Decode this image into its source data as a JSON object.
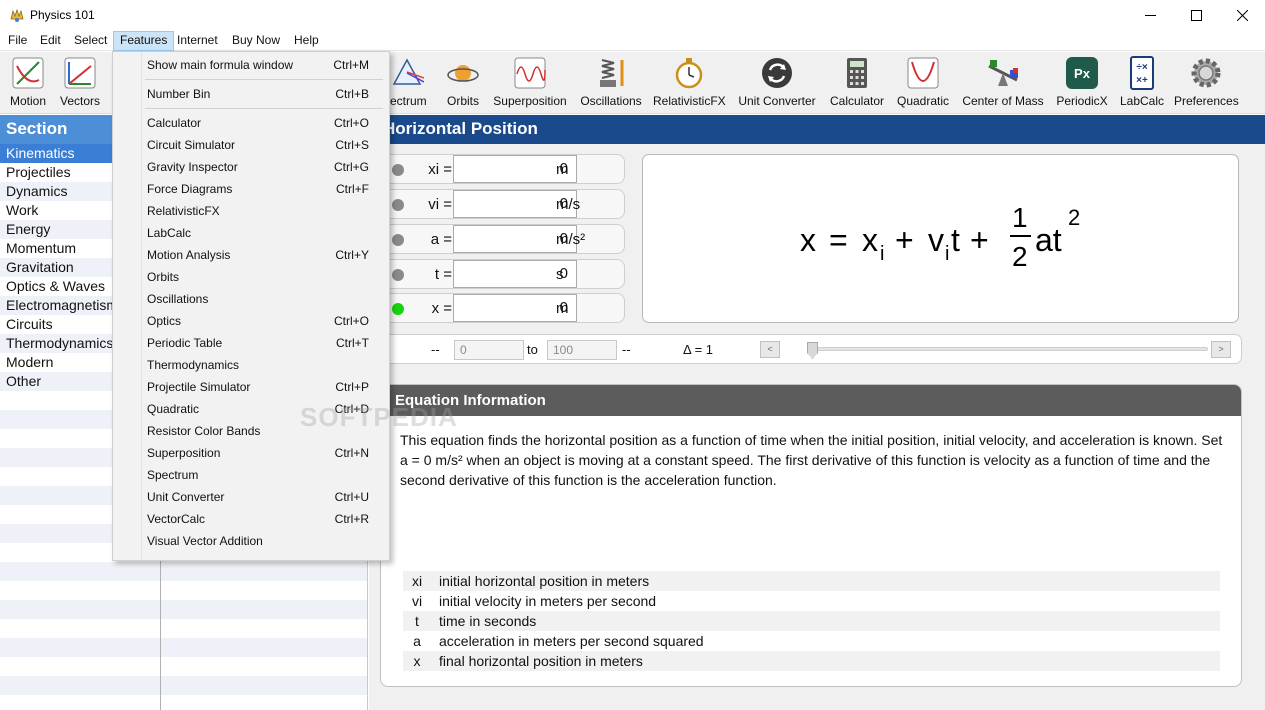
{
  "window": {
    "title": "Physics 101"
  },
  "menubar": [
    "File",
    "Edit",
    "Select",
    "Features",
    "Internet",
    "Buy Now",
    "Help"
  ],
  "toolbar": [
    {
      "label": "Motion",
      "icon": "motion-graph-icon"
    },
    {
      "label": "Vectors",
      "icon": "vectors-icon"
    },
    {
      "label": "Spectrum",
      "icon": "spectrum-prism-icon"
    },
    {
      "label": "Orbits",
      "icon": "orbits-planet-icon"
    },
    {
      "label": "Superposition",
      "icon": "superposition-wave-icon"
    },
    {
      "label": "Oscillations",
      "icon": "oscillations-spring-icon"
    },
    {
      "label": "RelativisticFX",
      "icon": "stopwatch-icon"
    },
    {
      "label": "Unit Converter",
      "icon": "unit-converter-icon"
    },
    {
      "label": "Calculator",
      "icon": "calculator-icon"
    },
    {
      "label": "Quadratic",
      "icon": "quadratic-parabola-icon"
    },
    {
      "label": "Center of Mass",
      "icon": "seesaw-icon"
    },
    {
      "label": "PeriodicX",
      "icon": "periodicx-icon"
    },
    {
      "label": "LabCalc",
      "icon": "labcalc-icon"
    },
    {
      "label": "Preferences",
      "icon": "gear-icon"
    }
  ],
  "sidebar": {
    "header": "Section",
    "items": [
      "Kinematics",
      "Projectiles",
      "Dynamics",
      "Work",
      "Energy",
      "Momentum",
      "Gravitation",
      "Optics & Waves",
      "Electromagnetism",
      "Circuits",
      "Thermodynamics",
      "Modern",
      "Other"
    ],
    "selected": "Kinematics"
  },
  "main": {
    "title": "Horizontal Position",
    "variables": [
      {
        "name": "xi =",
        "value": "0",
        "unit": "m",
        "active": false
      },
      {
        "name": "vi =",
        "value": "0",
        "unit": "m/s",
        "active": false
      },
      {
        "name": "a =",
        "value": "0",
        "unit": "m/s²",
        "active": false
      },
      {
        "name": "t =",
        "value": "0",
        "unit": "s",
        "active": false
      },
      {
        "name": "x =",
        "value": "0",
        "unit": "m",
        "active": true
      }
    ],
    "formula": {
      "lhs": "x",
      "eq": "=",
      "x": "x",
      "xsub": "i",
      "plus1": "+",
      "v": "v",
      "vsub": "i",
      "t": "t",
      "plus2": "+",
      "num": "1",
      "den": "2",
      "at": "at",
      "pow": "2"
    },
    "range": {
      "dash_left": "--",
      "from": "0",
      "to_label": "to",
      "to": "100",
      "dash_right": "--",
      "delta": "Δ = 1",
      "left_arrow": "<",
      "right_arrow": ">"
    },
    "info": {
      "header": "Equation Information",
      "text": "This equation finds the horizontal position as a function of time when the initial position, initial velocity, and acceleration is known. Set a = 0 m/s² when an object is moving at a constant speed. The first derivative of this function is velocity as a function of time and the second derivative of this function is the acceleration function.",
      "legend": [
        {
          "sym": "xi",
          "desc": "initial horizontal position in meters"
        },
        {
          "sym": "vi",
          "desc": "initial velocity in meters per second"
        },
        {
          "sym": "t",
          "desc": "time in seconds"
        },
        {
          "sym": "a",
          "desc": "acceleration in meters per second squared"
        },
        {
          "sym": "x",
          "desc": "final horizontal position in meters"
        }
      ]
    }
  },
  "features_menu": [
    {
      "label": "Show main formula window",
      "shortcut": "Ctrl+M"
    },
    {
      "separator": true
    },
    {
      "label": "Number Bin",
      "shortcut": "Ctrl+B"
    },
    {
      "separator": true
    },
    {
      "label": "Calculator",
      "shortcut": "Ctrl+O"
    },
    {
      "label": "Circuit Simulator",
      "shortcut": "Ctrl+S"
    },
    {
      "label": "Gravity Inspector",
      "shortcut": "Ctrl+G"
    },
    {
      "label": "Force Diagrams",
      "shortcut": "Ctrl+F"
    },
    {
      "label": "RelativisticFX",
      "shortcut": ""
    },
    {
      "label": "LabCalc",
      "shortcut": ""
    },
    {
      "label": "Motion Analysis",
      "shortcut": "Ctrl+Y"
    },
    {
      "label": "Orbits",
      "shortcut": ""
    },
    {
      "label": "Oscillations",
      "shortcut": ""
    },
    {
      "label": "Optics",
      "shortcut": "Ctrl+O"
    },
    {
      "label": "Periodic Table",
      "shortcut": "Ctrl+T"
    },
    {
      "label": "Thermodynamics",
      "shortcut": ""
    },
    {
      "label": "Projectile Simulator",
      "shortcut": "Ctrl+P"
    },
    {
      "label": "Quadratic",
      "shortcut": "Ctrl+D"
    },
    {
      "label": "Resistor Color Bands",
      "shortcut": ""
    },
    {
      "label": "Superposition",
      "shortcut": "Ctrl+N"
    },
    {
      "label": "Spectrum",
      "shortcut": ""
    },
    {
      "label": "Unit Converter",
      "shortcut": "Ctrl+U"
    },
    {
      "label": "VectorCalc",
      "shortcut": "Ctrl+R"
    },
    {
      "label": "Visual Vector Addition",
      "shortcut": ""
    }
  ],
  "watermark": "SOFTPEDIA",
  "colors": {
    "section_header": "#4d8fd6",
    "main_title": "#1a4a8c",
    "selected_item": "#3a7fd5",
    "active_dot": "#16d40c",
    "info_header": "#5c5c5c"
  }
}
